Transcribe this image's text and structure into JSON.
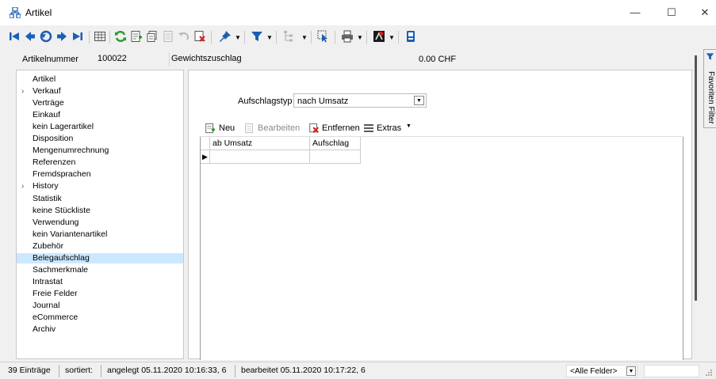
{
  "window": {
    "title": "Artikel",
    "minimize": "—",
    "maximize": "☐",
    "close": "✕"
  },
  "header": {
    "articlenumber_label": "Artikelnummer",
    "articlenumber_value": "100022",
    "description_value": "Gewichtszuschlag",
    "amount_value": "0.00 CHF"
  },
  "nav": {
    "items": [
      {
        "label": "Artikel",
        "expandable": false
      },
      {
        "label": "Verkauf",
        "expandable": true
      },
      {
        "label": "Verträge",
        "expandable": false
      },
      {
        "label": "Einkauf",
        "expandable": false
      },
      {
        "label": "kein Lagerartikel",
        "expandable": false
      },
      {
        "label": "Disposition",
        "expandable": false
      },
      {
        "label": "Mengenumrechnung",
        "expandable": false
      },
      {
        "label": "Referenzen",
        "expandable": false
      },
      {
        "label": "Fremdsprachen",
        "expandable": false
      },
      {
        "label": "History",
        "expandable": true
      },
      {
        "label": "Statistik",
        "expandable": false
      },
      {
        "label": "keine Stückliste",
        "expandable": false
      },
      {
        "label": "Verwendung",
        "expandable": false
      },
      {
        "label": "kein Variantenartikel",
        "expandable": false
      },
      {
        "label": "Zubehör",
        "expandable": false
      },
      {
        "label": "Belegaufschlag",
        "expandable": false
      },
      {
        "label": "Sachmerkmale",
        "expandable": false
      },
      {
        "label": "Intrastat",
        "expandable": false
      },
      {
        "label": "Freie Felder",
        "expandable": false
      },
      {
        "label": "Journal",
        "expandable": false
      },
      {
        "label": "eCommerce",
        "expandable": false
      },
      {
        "label": "Archiv",
        "expandable": false
      }
    ],
    "selected_index": 15
  },
  "content": {
    "aufschlag_label": "Aufschlagstyp",
    "aufschlag_value": "nach Umsatz",
    "buttons": {
      "neu": "Neu",
      "bearbeiten": "Bearbeiten",
      "entfernen": "Entfernen",
      "extras": "Extras"
    },
    "grid": {
      "columns": [
        "ab Umsatz",
        "Aufschlag"
      ],
      "rows": [
        [
          "",
          ""
        ]
      ]
    }
  },
  "side_panel": {
    "label": "Favoriten Filter"
  },
  "status": {
    "count": "39 Einträge",
    "sorted": "sortiert:",
    "created": "angelegt 05.11.2020 10:16:33,  6",
    "edited": "bearbeitet 05.11.2020 10:17:22,  6",
    "field_filter": "<Alle Felder>"
  },
  "colors": {
    "selected": "#cce8ff",
    "blue_icon": "#1a5fb4",
    "green_icon": "#2a9a2a",
    "red_icon": "#d42020"
  }
}
